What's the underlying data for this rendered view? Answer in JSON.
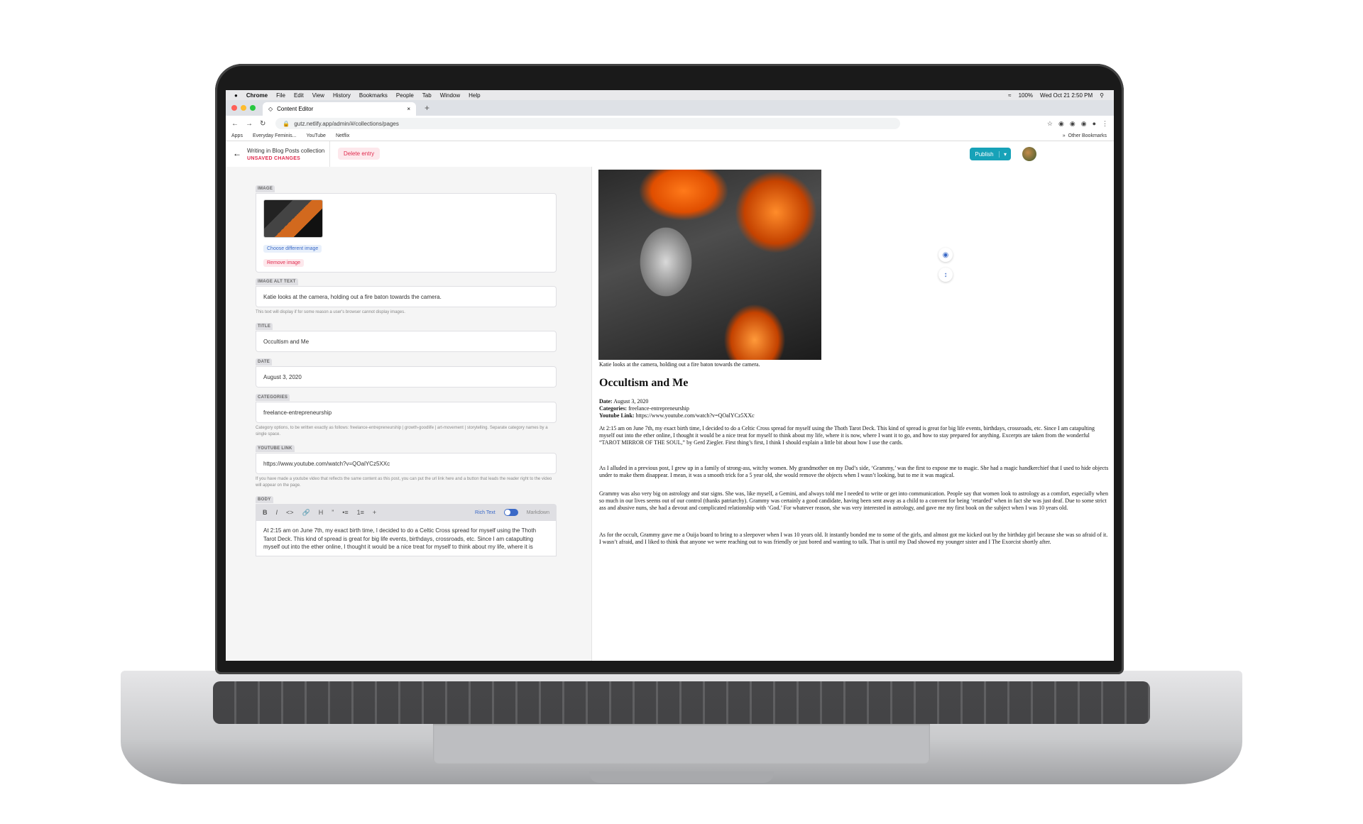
{
  "menubar": {
    "apple": "",
    "app": "Chrome",
    "items": [
      "File",
      "Edit",
      "View",
      "History",
      "Bookmarks",
      "People",
      "Tab",
      "Window",
      "Help"
    ],
    "battery": "100%",
    "clock": "Wed Oct 21  2:50 PM"
  },
  "tab": {
    "title": "Content Editor",
    "close": "×",
    "new": "+"
  },
  "omnibox": {
    "url": "gutz.netlify.app/admin/#/collections/pages"
  },
  "bookmarks": {
    "apps": "Apps",
    "feminist": "Everyday Feminis...",
    "youtube": "YouTube",
    "netflix": "Netflix",
    "more": "»",
    "other": "Other Bookmarks"
  },
  "cms": {
    "collection": "Writing in Blog Posts collection",
    "unsaved": "UNSAVED CHANGES",
    "delete": "Delete entry",
    "publish": "Publish"
  },
  "fields": {
    "image_label": "IMAGE",
    "choose": "Choose different image",
    "remove": "Remove image",
    "alt_label": "IMAGE ALT TEXT",
    "alt_value": "Katie looks at the camera, holding out a fire baton towards the camera.",
    "alt_hint": "This text will display if for some reason a user's browser cannot display images.",
    "title_label": "TITLE",
    "title_value": "Occultism and Me",
    "date_label": "DATE",
    "date_value": "August 3, 2020",
    "categories_label": "CATEGORIES",
    "categories_value": "freelance-entrepreneurship",
    "categories_hint": "Category options, to be written exactly as follows: freelance-entrepreneurship | growth-goodlife | art-movement | storytelling. Separate category names by a single space.",
    "youtube_label": "YOUTUBE LINK",
    "youtube_value": "https://www.youtube.com/watch?v=QOalYCz5XXc",
    "youtube_hint": "If you have made a youtube video that reflects the same content as this post, you can put the url link here and a button that leads the reader right to the video will appear on the page.",
    "body_label": "BODY",
    "rich_text": "Rich Text",
    "markdown": "Markdown",
    "body_value": "At 2:15 am on June 7th, my exact birth time, I decided to do a Celtic Cross spread for myself using the Thoth Tarot Deck. This kind of spread is great for big life events, birthdays, crossroads, etc. Since I am catapulting myself out into the ether online, I thought it would be a nice treat for myself to think about my life, where it is"
  },
  "preview": {
    "caption": "Katie looks at the camera, holding out a fire baton towards the camera.",
    "title": "Occultism and Me",
    "date_label": "Date:",
    "date": " August 3, 2020",
    "categories_label": "Categories:",
    "categories": " freelance-entrepreneurship",
    "youtube_label": "Youtube Link:",
    "youtube": " https://www.youtube.com/watch?v=QOalYCz5XXc",
    "p1": "At 2:15 am on June 7th, my exact birth time, I decided to do a Celtic Cross spread for myself using the Thoth Tarot Deck. This kind of spread is great for big life events, birthdays, crossroads, etc. Since I am catapulting myself out into the ether online, I thought it would be a nice treat for myself to think about my life, where it is now, where I want it to go, and how to stay prepared for anything. Excerpts are taken from the wonderful “TAROT MIRROR OF THE SOUL,” by Gerd Ziegler. First thing’s first, I think I should explain a little bit about how I use the cards.",
    "p2": "As I alluded in a previous post, I grew up in a family of strong-ass, witchy women. My grandmother on my Dad’s side, ‘Grammy,’ was the first to expose me to magic. She had a magic handkerchief that I used to hide objects under to make them disappear. I mean, it was a smooth trick for a 5 year old, she would remove the objects when I wasn’t looking, but to me it was magical.",
    "p3": "Grammy was also very big on astrology and star signs. She was, like myself, a Gemini, and always told me I needed to write or get into communication. People say that women look to astrology as a comfort, especially when so much in our lives seems out of our control (thanks patriarchy). Grammy was certainly a good candidate, having been sent away as a child to a convent for being ‘retarded’ when in fact she was just deaf. Due to some strict ass and abusive nuns, she had a devout and complicated relationship with ‘God.’ For whatever reason, she was very interested in astrology, and gave me my first book on the subject when I was 10 years old.",
    "p4": "As for the occult, Grammy gave me a Ouija board to bring to a sleepover when I was 10 years old. It instantly bonded me to some of the girls, and almost got me kicked out by the birthday girl because she was so afraid of it. I wasn’t afraid, and I liked to think that anyone we were reaching out to was friendly or just bored and wanting to talk. That is until my Dad showed my younger sister and I The Exorcist shortly after."
  },
  "colors": {
    "accent": "#17a2b8",
    "danger": "#e02b4e",
    "link": "#3a69c7"
  }
}
